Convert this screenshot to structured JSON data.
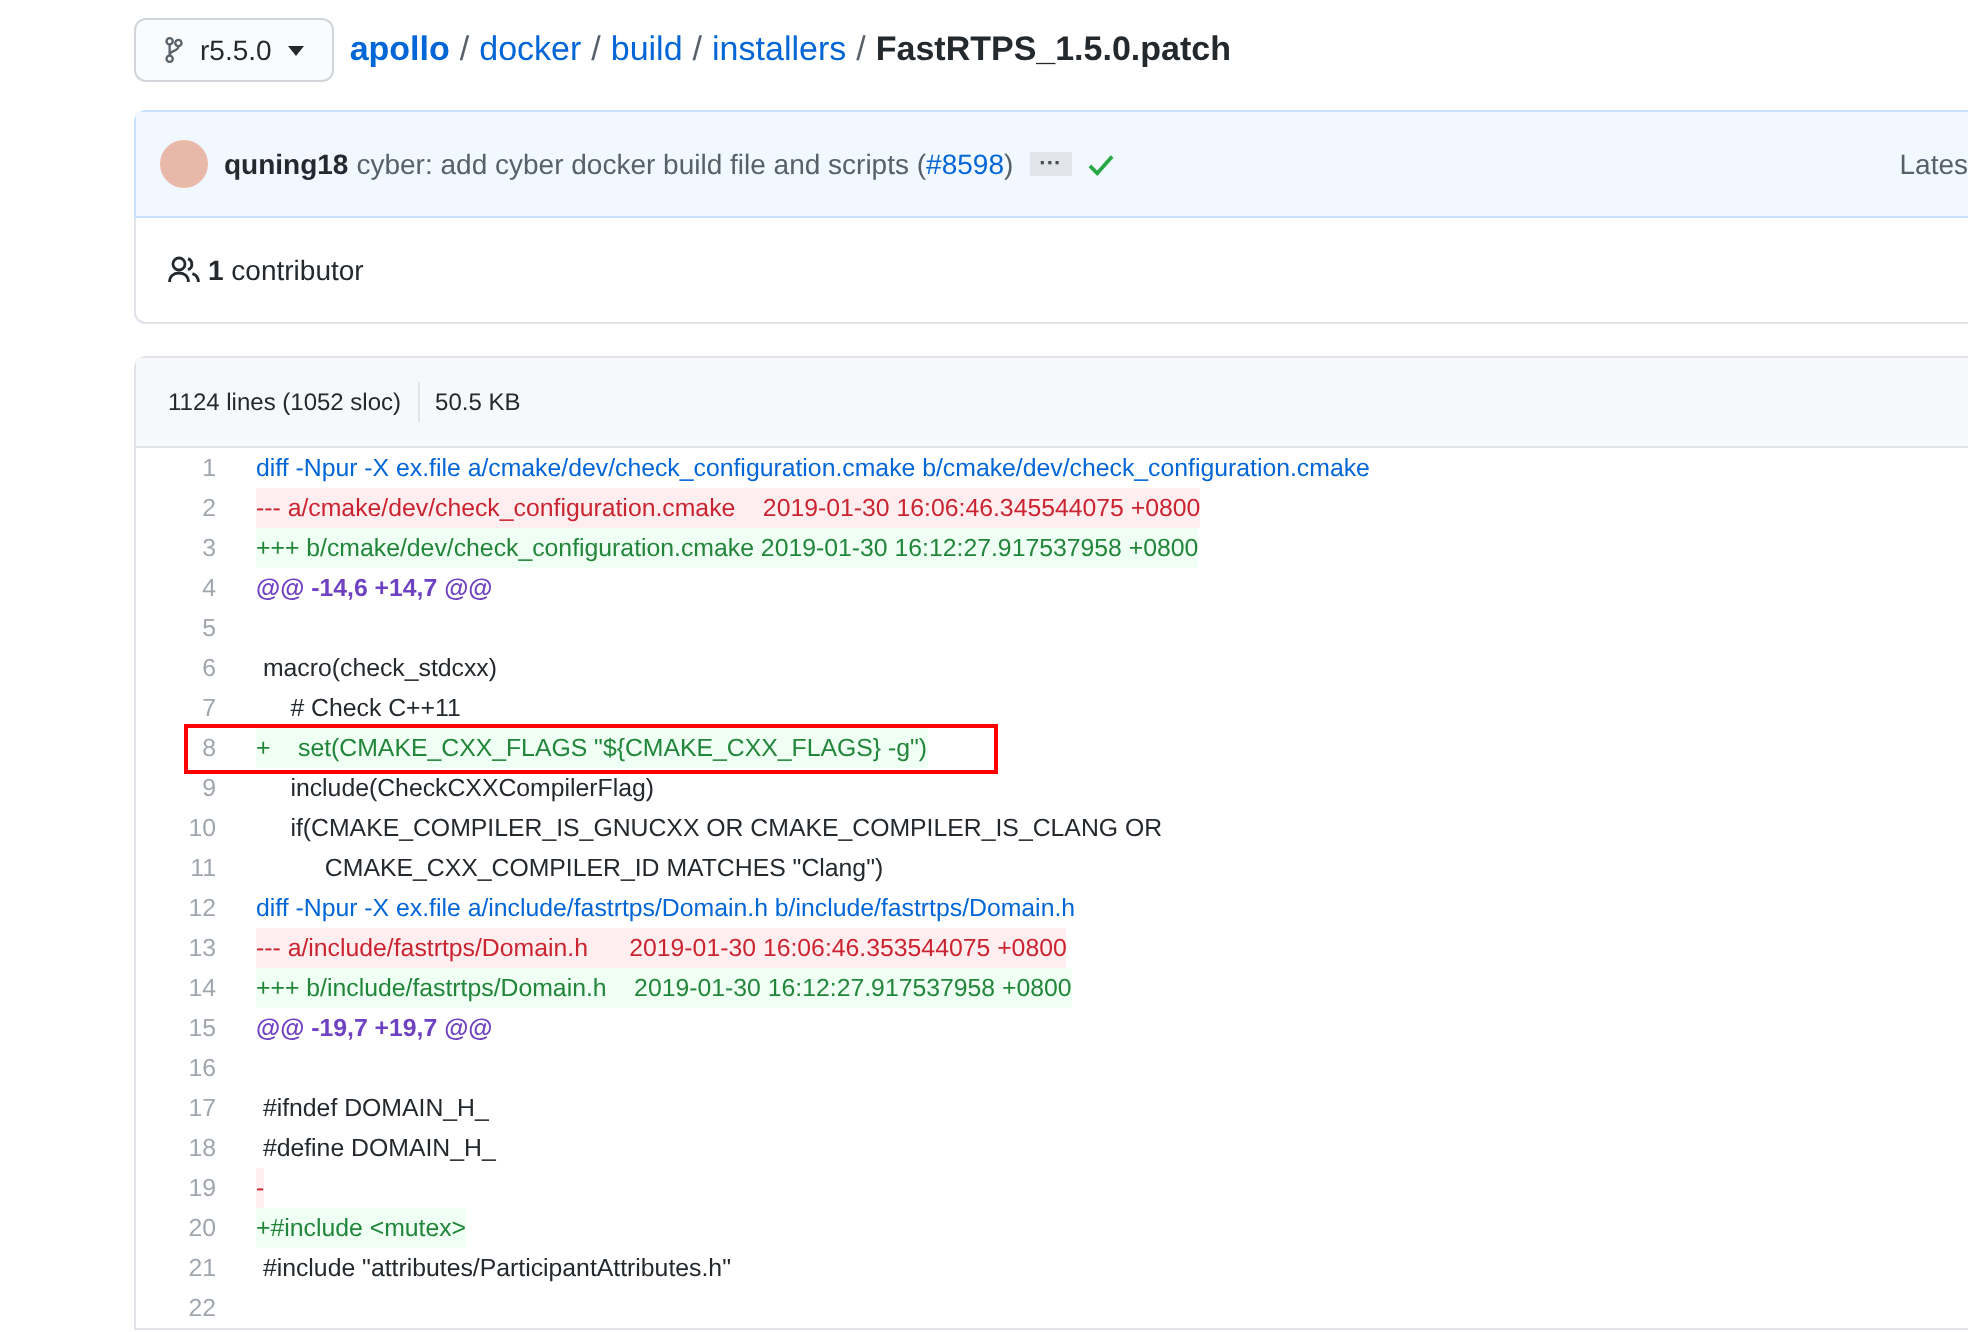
{
  "branch": {
    "label": "r5.5.0"
  },
  "breadcrumb": {
    "parts": [
      "apollo",
      "docker",
      "build",
      "installers"
    ],
    "separator": "/",
    "file": "FastRTPS_1.5.0.patch"
  },
  "commit": {
    "author": "quning18",
    "message": "cyber: add cyber docker build file and scripts (",
    "pr": "#8598",
    "message_end": ")",
    "more": "···",
    "checks_passed": true,
    "right": "Lates"
  },
  "contributors": {
    "count": "1",
    "label": "contributor"
  },
  "file_info": {
    "lines": "1124 lines (1052 sloc)",
    "size": "50.5 KB"
  },
  "lines": [
    {
      "number": "1",
      "kind": "meta",
      "text": "diff -Npur -X ex.file a/cmake/dev/check_configuration.cmake b/cmake/dev/check_configuration.cmake",
      "boxed": false
    },
    {
      "number": "2",
      "kind": "del",
      "text": "--- a/cmake/dev/check_configuration.cmake    2019-01-30 16:06:46.345544075 +0800",
      "boxed": false
    },
    {
      "number": "3",
      "kind": "add",
      "text": "+++ b/cmake/dev/check_configuration.cmake 2019-01-30 16:12:27.917537958 +0800",
      "boxed": false
    },
    {
      "number": "4",
      "kind": "hunk",
      "text": "@@ -14,6 +14,7 @@",
      "boxed": false
    },
    {
      "number": "5",
      "boxed": false
    },
    {
      "number": "6",
      "kind": "context",
      "text": " macro(check_stdcxx)",
      "boxed": false
    },
    {
      "number": "7",
      "kind": "context",
      "text": "     # Check C++11",
      "boxed": false
    },
    {
      "number": "8",
      "kind": "add",
      "text": "+    set(CMAKE_CXX_FLAGS \"${CMAKE_CXX_FLAGS} -g\")",
      "boxed": true
    },
    {
      "number": "9",
      "kind": "context",
      "text": "     include(CheckCXXCompilerFlag)",
      "boxed": false
    },
    {
      "number": "10",
      "kind": "context",
      "text": "     if(CMAKE_COMPILER_IS_GNUCXX OR CMAKE_COMPILER_IS_CLANG OR",
      "boxed": false
    },
    {
      "number": "11",
      "kind": "context",
      "text": "          CMAKE_CXX_COMPILER_ID MATCHES \"Clang\")",
      "boxed": false
    },
    {
      "number": "12",
      "kind": "meta",
      "text": "diff -Npur -X ex.file a/include/fastrtps/Domain.h b/include/fastrtps/Domain.h",
      "boxed": false
    },
    {
      "number": "13",
      "kind": "del",
      "text": "--- a/include/fastrtps/Domain.h      2019-01-30 16:06:46.353544075 +0800",
      "boxed": false
    },
    {
      "number": "14",
      "kind": "add",
      "text": "+++ b/include/fastrtps/Domain.h    2019-01-30 16:12:27.917537958 +0800",
      "boxed": false
    },
    {
      "number": "15",
      "kind": "hunk",
      "text": "@@ -19,7 +19,7 @@",
      "boxed": false
    },
    {
      "number": "16",
      "boxed": false
    },
    {
      "number": "17",
      "kind": "context",
      "text": " #ifndef DOMAIN_H_",
      "boxed": false
    },
    {
      "number": "18",
      "kind": "context",
      "text": " #define DOMAIN_H_",
      "boxed": false
    },
    {
      "number": "19",
      "kind": "del",
      "text": "-",
      "boxed": false
    },
    {
      "number": "20",
      "kind": "add",
      "text": "+#include <mutex>",
      "boxed": false
    },
    {
      "number": "21",
      "kind": "context",
      "text": " #include \"attributes/ParticipantAttributes.h\"",
      "boxed": false
    },
    {
      "number": "22",
      "boxed": false
    }
  ]
}
